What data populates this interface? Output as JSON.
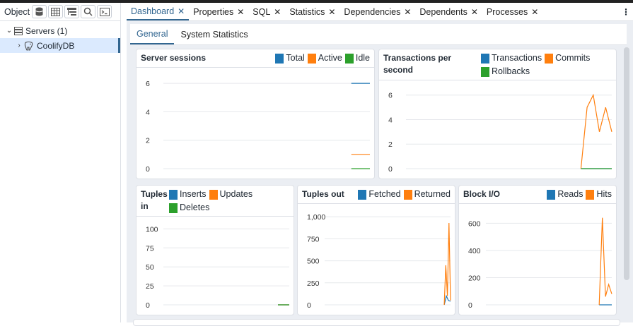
{
  "colors": {
    "total": "#1f77b4",
    "active": "#ff7f0e",
    "idle": "#2ca02c",
    "accent": "#326690"
  },
  "object_bar": {
    "label": "Object",
    "icons": [
      "database-icon",
      "table-grid-icon",
      "tree-view-icon",
      "search-icon",
      "terminal-icon"
    ]
  },
  "tree": [
    {
      "label": "Servers (1)",
      "icon": "server-icon",
      "expanded": true
    },
    {
      "label": "CoolifyDB",
      "icon": "elephant-icon",
      "expanded": false,
      "selected": true
    }
  ],
  "tabs": [
    {
      "label": "Dashboard",
      "active": true
    },
    {
      "label": "Properties"
    },
    {
      "label": "SQL"
    },
    {
      "label": "Statistics"
    },
    {
      "label": "Dependencies"
    },
    {
      "label": "Dependents"
    },
    {
      "label": "Processes"
    }
  ],
  "tab_close": "✕",
  "more_menu": "⋮",
  "subtabs": [
    {
      "label": "General",
      "active": true
    },
    {
      "label": "System Statistics"
    }
  ],
  "chart_data": [
    {
      "type": "line",
      "title": "Server sessions",
      "ylim": [
        0,
        6.5
      ],
      "yticks": [
        0,
        2,
        4,
        6
      ],
      "ytick_labels": [
        "0",
        "2",
        "4",
        "6"
      ],
      "series": [
        {
          "name": "Total",
          "color": "#1f77b4",
          "values": [
            6,
            6
          ]
        },
        {
          "name": "Active",
          "color": "#ff7f0e",
          "values": [
            1,
            1
          ]
        },
        {
          "name": "Idle",
          "color": "#2ca02c",
          "values": [
            0,
            0
          ]
        }
      ],
      "x_start": 0.91
    },
    {
      "type": "line",
      "title": "Transactions per second",
      "ylim": [
        0,
        6.5
      ],
      "yticks": [
        0,
        2,
        4,
        6
      ],
      "ytick_labels": [
        "0",
        "2",
        "4",
        "6"
      ],
      "series": [
        {
          "name": "Transactions",
          "color": "#1f77b4",
          "values": [
            0,
            0
          ]
        },
        {
          "name": "Commits",
          "color": "#ff7f0e",
          "values": [
            0,
            5,
            6,
            3,
            5,
            3
          ]
        },
        {
          "name": "Rollbacks",
          "color": "#2ca02c",
          "values": [
            0,
            0
          ]
        }
      ],
      "x_start": 0.85
    },
    {
      "type": "line",
      "title": "Tuples in",
      "ylim": [
        0,
        105
      ],
      "yticks": [
        0,
        25,
        50,
        75,
        100
      ],
      "ytick_labels": [
        "0",
        "25",
        "50",
        "75",
        "100"
      ],
      "series": [
        {
          "name": "Inserts",
          "color": "#1f77b4",
          "values": [
            0,
            0
          ]
        },
        {
          "name": "Updates",
          "color": "#ff7f0e",
          "values": [
            0,
            0
          ]
        },
        {
          "name": "Deletes",
          "color": "#2ca02c",
          "values": [
            0,
            0
          ]
        }
      ],
      "x_start": 0.91
    },
    {
      "type": "line",
      "title": "Tuples out",
      "ylim": [
        0,
        1050
      ],
      "yticks": [
        0,
        250,
        500,
        750,
        1000
      ],
      "ytick_labels": [
        "0",
        "250",
        "500",
        "750",
        "1,000"
      ],
      "series": [
        {
          "name": "Fetched",
          "color": "#1f77b4",
          "values": [
            0,
            100,
            50,
            40
          ]
        },
        {
          "name": "Returned",
          "color": "#ff7f0e",
          "values": [
            0,
            450,
            100,
            930,
            50
          ]
        }
      ],
      "x_start": 0.95
    },
    {
      "type": "line",
      "title": "Block I/O",
      "ylim": [
        0,
        680
      ],
      "yticks": [
        0,
        200,
        400,
        600
      ],
      "ytick_labels": [
        "0",
        "200",
        "400",
        "600"
      ],
      "series": [
        {
          "name": "Reads",
          "color": "#1f77b4",
          "values": [
            0,
            0
          ]
        },
        {
          "name": "Hits",
          "color": "#ff7f0e",
          "values": [
            0,
            640,
            60,
            150,
            80
          ]
        }
      ],
      "x_start": 0.9
    }
  ]
}
